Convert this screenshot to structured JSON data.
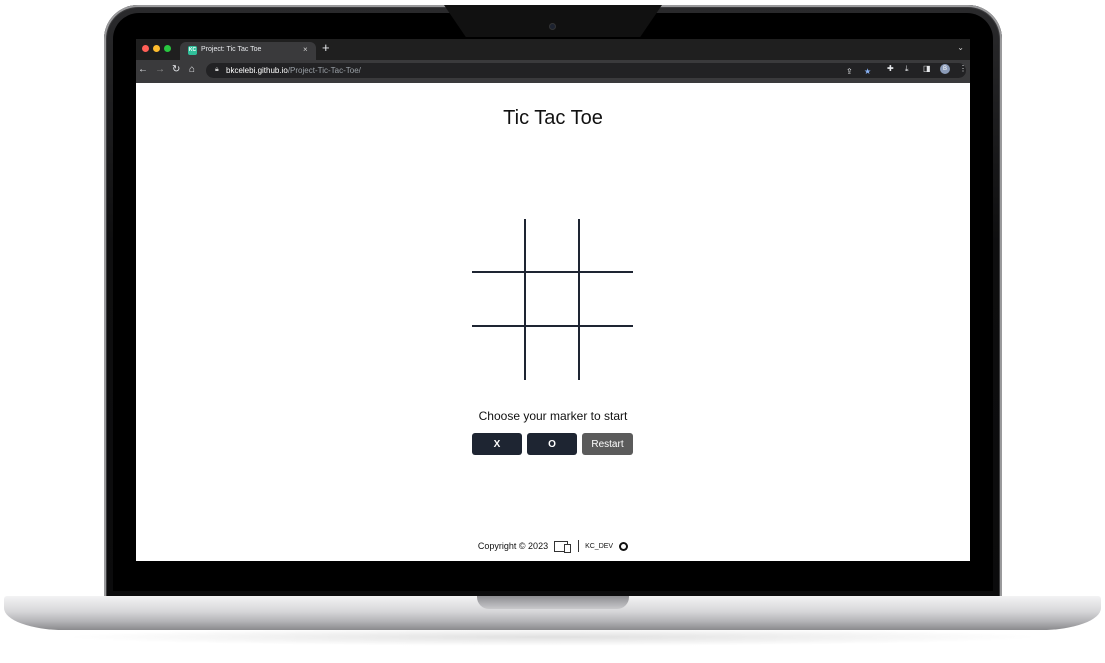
{
  "browser": {
    "tab_title": "Project: Tic Tac Toe",
    "tab_close": "×",
    "new_tab": "+",
    "tab_menu": "⌄",
    "back": "←",
    "forward": "→",
    "reload": "↻",
    "home": "⌂",
    "url_host": "bkcelebi.github.io",
    "url_path": "/Project-Tic-Tac-Toe/",
    "profile_initial": "B",
    "favicon_text": "KC"
  },
  "game": {
    "title": "Tic Tac Toe",
    "prompt": "Choose your marker to start",
    "buttons": {
      "x": "X",
      "o": "O",
      "restart": "Restart"
    }
  },
  "footer": {
    "copyright": "Copyright © 2023",
    "brand": "KC_DEV"
  },
  "colors": {
    "grid": "#1e2532",
    "button_dark": "#1e2532",
    "button_restart": "#5b5b5b"
  }
}
